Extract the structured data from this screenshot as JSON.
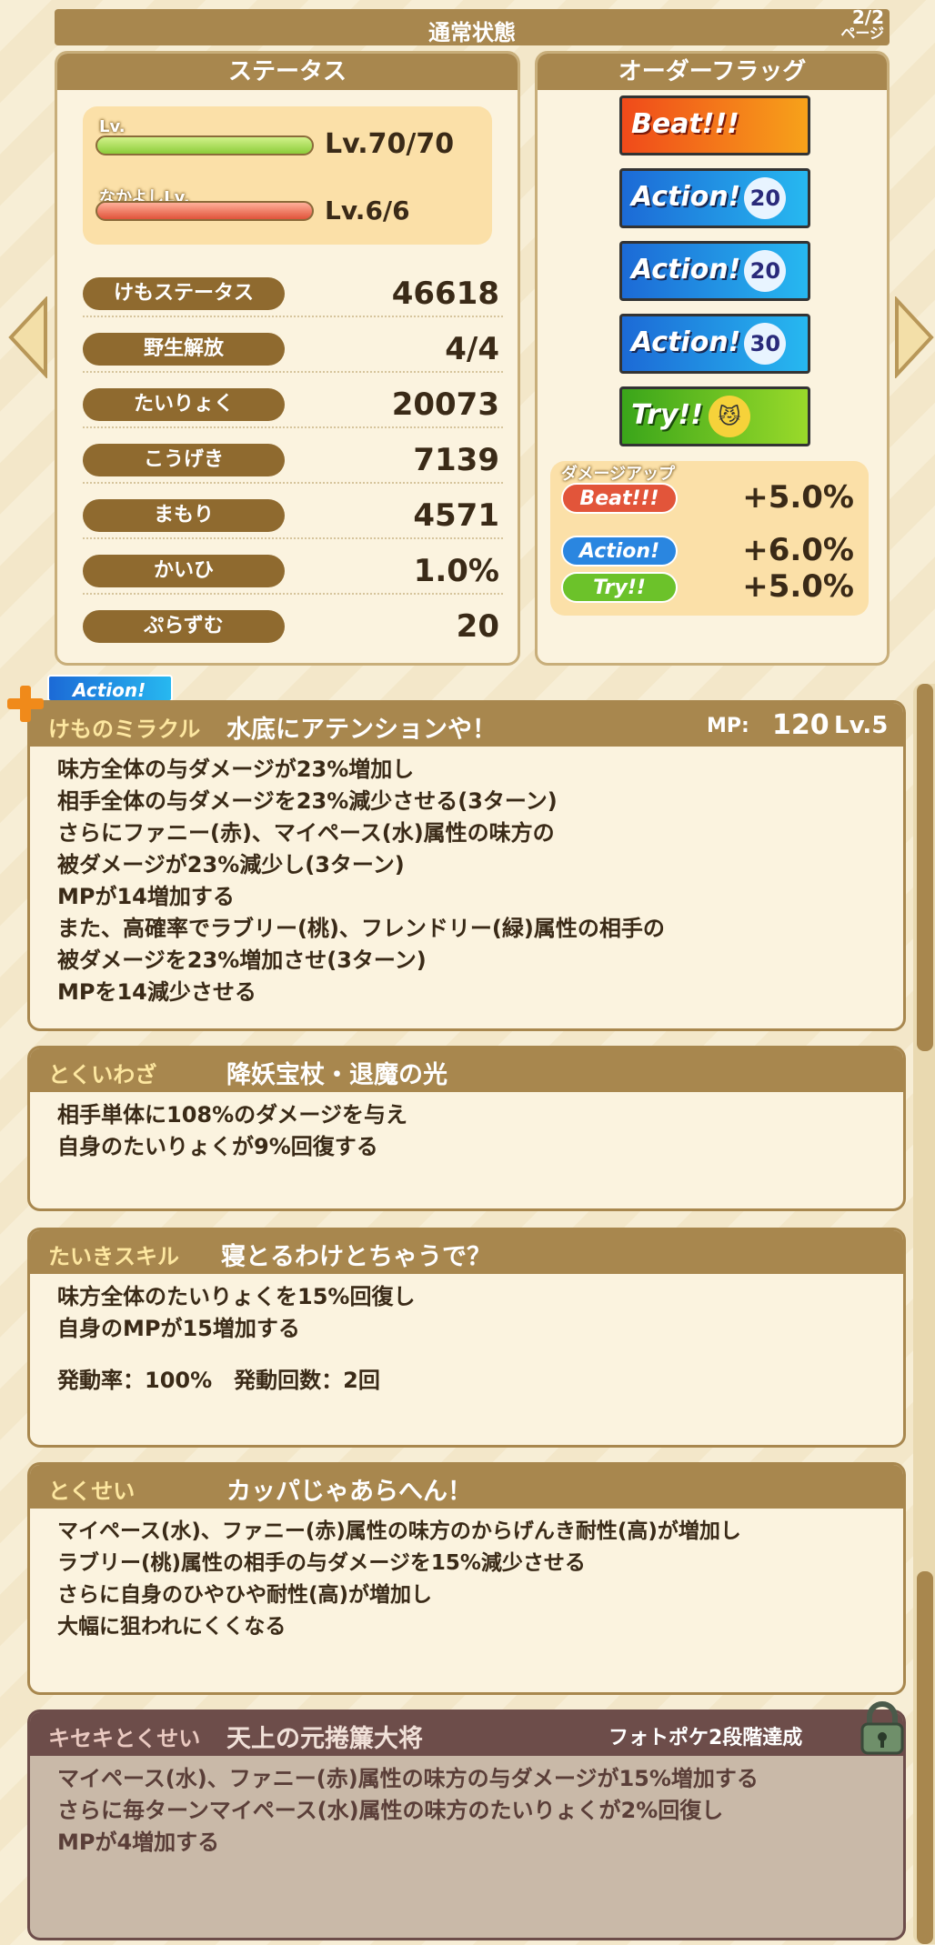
{
  "header": {
    "title": "通常状態",
    "page_line1": "2/2",
    "page_line2": "ページ"
  },
  "status": {
    "title": "ステータス",
    "lv_label": "Lv.",
    "lv_value": "Lv.70/70",
    "friend_label": "なかよしLv.",
    "friend_value": "Lv.6/6",
    "stats": [
      {
        "label": "けもステータス",
        "value": "46618"
      },
      {
        "label": "野生解放",
        "value": "4/4"
      },
      {
        "label": "たいりょく",
        "value": "20073"
      },
      {
        "label": "こうげき",
        "value": "7139"
      },
      {
        "label": "まもり",
        "value": "4571"
      },
      {
        "label": "かいひ",
        "value": "1.0%"
      },
      {
        "label": "ぷらずむ",
        "value": "20"
      }
    ]
  },
  "order": {
    "title": "オーダーフラッグ",
    "flags": [
      {
        "label": "Beat!!!",
        "num": ""
      },
      {
        "label": "Action!",
        "num": "20"
      },
      {
        "label": "Action!",
        "num": "20"
      },
      {
        "label": "Action!",
        "num": "30"
      },
      {
        "label": "Try!!",
        "num": ""
      }
    ],
    "damage_title": "ダメージアップ",
    "damage": [
      {
        "label": "Beat!!!",
        "value": "+5.0%"
      },
      {
        "label": "Action!",
        "value": "+6.0%"
      },
      {
        "label": "Try!!",
        "value": "+5.0%"
      }
    ]
  },
  "miracle": {
    "badge": "Action!",
    "category": "けものミラクル",
    "name": "水底にアテンションや！",
    "mp_label": "MP:",
    "mp": "120",
    "lv": "Lv.5",
    "lines": [
      "味方全体の与ダメージが23%増加し",
      "相手全体の与ダメージを23%減少させる(3ターン)",
      "さらにファニー(赤)、マイペース(水)属性の味方の",
      "被ダメージが23%減少し(3ターン)",
      "MPが14増加する",
      "また、高確率でラブリー(桃)、フレンドリー(緑)属性の相手の",
      "被ダメージを23%増加させ(3ターン)",
      "MPを14減少させる"
    ]
  },
  "special": {
    "category": "とくいわざ",
    "name": "降妖宝杖・退魔の光",
    "lines": [
      "相手単体に108%のダメージを与え",
      "自身のたいりょくが9%回復する"
    ]
  },
  "standby": {
    "category": "たいきスキル",
    "name": "寝とるわけとちゃうで？",
    "lines": [
      "味方全体のたいりょくを15%回復し",
      "自身のMPが15増加する",
      "",
      "発動率：100%　発動回数：2回"
    ]
  },
  "trait": {
    "category": "とくせい",
    "name": "カッパじゃあらへん！",
    "lines": [
      "マイペース(水)、ファニー(赤)属性の味方のからげんき耐性(高)が増加し",
      "ラブリー(桃)属性の相手の与ダメージを15%減少させる",
      "さらに自身のひやひや耐性(高)が増加し",
      "大幅に狙われにくくなる"
    ]
  },
  "kiseki": {
    "category": "キセキとくせい",
    "name": "天上の元捲簾大将",
    "condition": "フォトポケ2段階達成",
    "lines": [
      "マイペース(水)、ファニー(赤)属性の味方の与ダメージが15%増加する",
      "さらに毎ターンマイペース(水)属性の味方のたいりょくが2%回復し",
      "MPが4増加する"
    ]
  }
}
